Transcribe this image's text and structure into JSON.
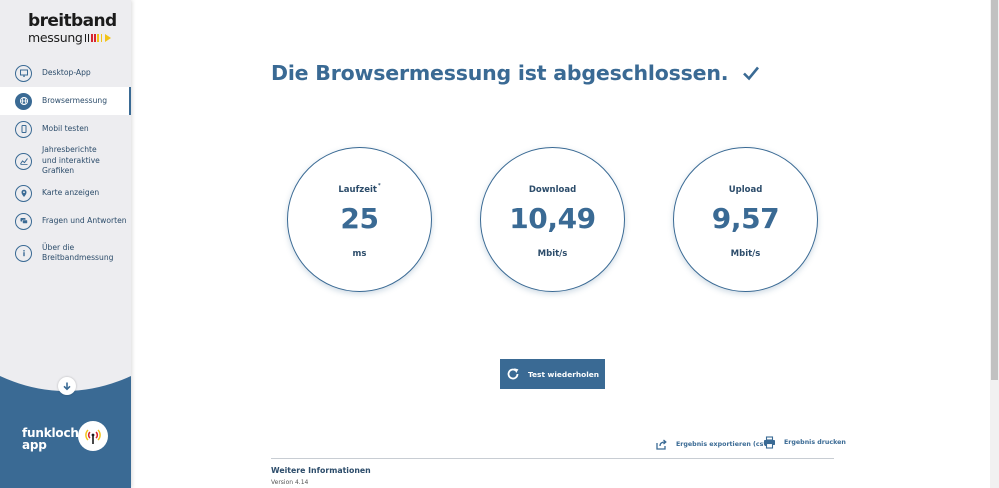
{
  "logo": {
    "line1": "breitband",
    "line2": "messung"
  },
  "sidebar": {
    "items": [
      {
        "label": "Desktop-App",
        "icon": "monitor-icon"
      },
      {
        "label": "Browsermessung",
        "icon": "globe-icon",
        "active": true
      },
      {
        "label": "Mobil testen",
        "icon": "smartphone-icon"
      },
      {
        "label": "Jahresberichte und interaktive Grafiken",
        "icon": "chart-icon"
      },
      {
        "label": "Karte anzeigen",
        "icon": "map-pin-icon"
      },
      {
        "label": "Fragen und Antworten",
        "icon": "chat-icon"
      },
      {
        "label": "Über die Breitbandmessung",
        "icon": "info-icon"
      }
    ],
    "funkloch": {
      "line1": "funkloch-",
      "line2": "app"
    }
  },
  "main": {
    "title": "Die Browsermessung ist abgeschlossen.",
    "results": [
      {
        "label": "Laufzeit",
        "marker": "*",
        "value": "25",
        "unit": "ms"
      },
      {
        "label": "Download",
        "value": "10,49",
        "unit": "Mbit/s"
      },
      {
        "label": "Upload",
        "value": "9,57",
        "unit": "Mbit/s"
      }
    ],
    "repeat_button": "Test wiederholen",
    "export_label": "Ergebnis exportieren (csv)",
    "print_label": "Ergebnis drucken",
    "more_info": "Weitere Informationen",
    "version": "Version 4.14"
  },
  "colors": {
    "primary": "#3a6a94",
    "sidebar_bg": "#ededf0",
    "accent_yellow": "#f2c318"
  }
}
